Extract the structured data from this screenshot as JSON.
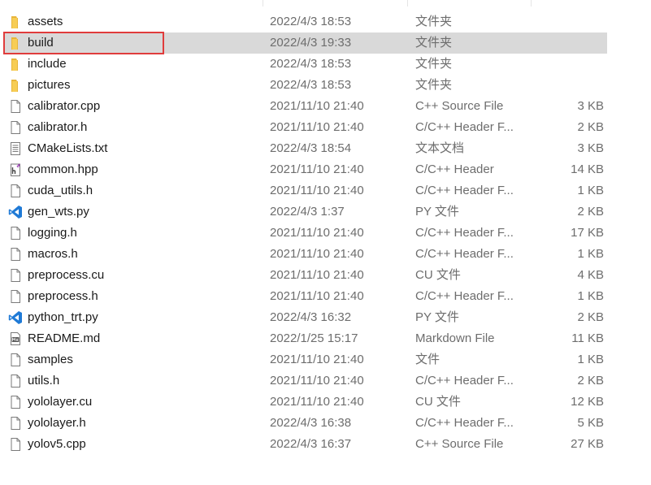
{
  "files": [
    {
      "name": "assets",
      "date": "2022/4/3 18:53",
      "type": "文件夹",
      "size": "",
      "icon": "folder-icon"
    },
    {
      "name": "build",
      "date": "2022/4/3 19:33",
      "type": "文件夹",
      "size": "",
      "icon": "folder-icon",
      "selected": true,
      "highlighted": true
    },
    {
      "name": "include",
      "date": "2022/4/3 18:53",
      "type": "文件夹",
      "size": "",
      "icon": "folder-icon"
    },
    {
      "name": "pictures",
      "date": "2022/4/3 18:53",
      "type": "文件夹",
      "size": "",
      "icon": "folder-icon"
    },
    {
      "name": "calibrator.cpp",
      "date": "2021/11/10 21:40",
      "type": "C++ Source File",
      "size": "3 KB",
      "icon": "file-icon"
    },
    {
      "name": "calibrator.h",
      "date": "2021/11/10 21:40",
      "type": "C/C++ Header F...",
      "size": "2 KB",
      "icon": "file-icon"
    },
    {
      "name": "CMakeLists.txt",
      "date": "2022/4/3 18:54",
      "type": "文本文档",
      "size": "3 KB",
      "icon": "text-file-icon"
    },
    {
      "name": "common.hpp",
      "date": "2021/11/10 21:40",
      "type": "C/C++ Header",
      "size": "14 KB",
      "icon": "header-file-icon"
    },
    {
      "name": "cuda_utils.h",
      "date": "2021/11/10 21:40",
      "type": "C/C++ Header F...",
      "size": "1 KB",
      "icon": "file-icon"
    },
    {
      "name": "gen_wts.py",
      "date": "2022/4/3 1:37",
      "type": "PY 文件",
      "size": "2 KB",
      "icon": "vscode-icon"
    },
    {
      "name": "logging.h",
      "date": "2021/11/10 21:40",
      "type": "C/C++ Header F...",
      "size": "17 KB",
      "icon": "file-icon"
    },
    {
      "name": "macros.h",
      "date": "2021/11/10 21:40",
      "type": "C/C++ Header F...",
      "size": "1 KB",
      "icon": "file-icon"
    },
    {
      "name": "preprocess.cu",
      "date": "2021/11/10 21:40",
      "type": "CU 文件",
      "size": "4 KB",
      "icon": "file-icon"
    },
    {
      "name": "preprocess.h",
      "date": "2021/11/10 21:40",
      "type": "C/C++ Header F...",
      "size": "1 KB",
      "icon": "file-icon"
    },
    {
      "name": "python_trt.py",
      "date": "2022/4/3 16:32",
      "type": "PY 文件",
      "size": "2 KB",
      "icon": "vscode-icon"
    },
    {
      "name": "README.md",
      "date": "2022/1/25 15:17",
      "type": "Markdown File",
      "size": "11 KB",
      "icon": "markdown-file-icon"
    },
    {
      "name": "samples",
      "date": "2021/11/10 21:40",
      "type": "文件",
      "size": "1 KB",
      "icon": "file-icon"
    },
    {
      "name": "utils.h",
      "date": "2021/11/10 21:40",
      "type": "C/C++ Header F...",
      "size": "2 KB",
      "icon": "file-icon"
    },
    {
      "name": "yololayer.cu",
      "date": "2021/11/10 21:40",
      "type": "CU 文件",
      "size": "12 KB",
      "icon": "file-icon"
    },
    {
      "name": "yololayer.h",
      "date": "2022/4/3 16:38",
      "type": "C/C++ Header F...",
      "size": "5 KB",
      "icon": "file-icon"
    },
    {
      "name": "yolov5.cpp",
      "date": "2022/4/3 16:37",
      "type": "C++ Source File",
      "size": "27 KB",
      "icon": "file-icon"
    }
  ],
  "colors": {
    "selection": "#d9d9d9",
    "highlight_border": "#e03c3c",
    "folder": "#f5c542",
    "vscode": "#1f7ad6"
  }
}
